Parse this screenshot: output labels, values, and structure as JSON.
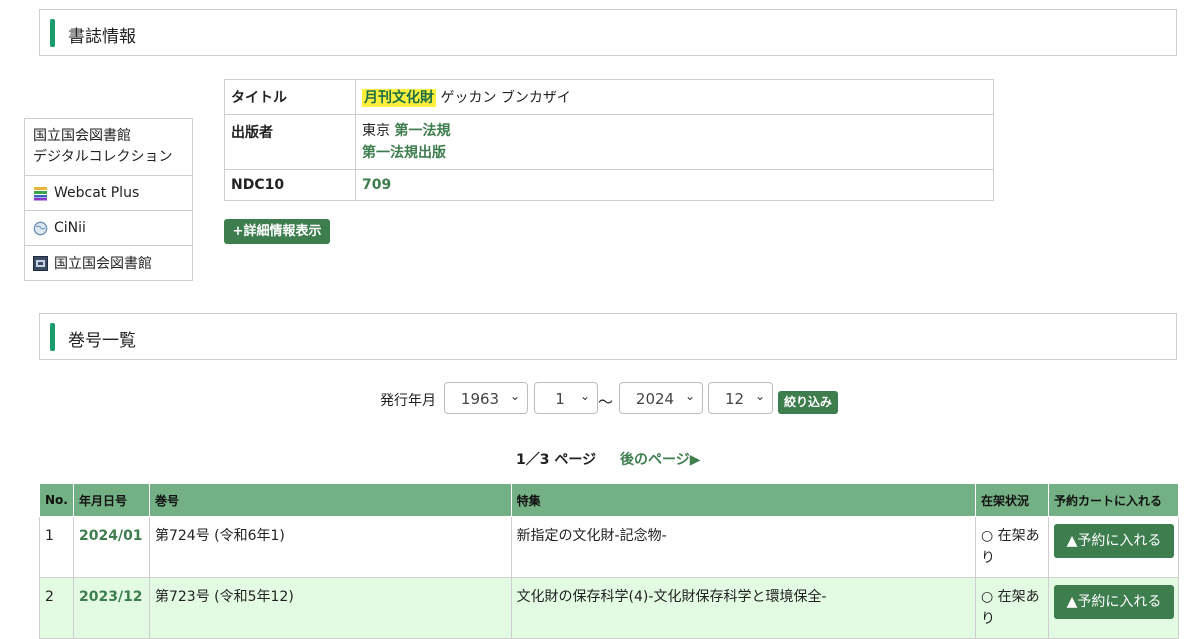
{
  "sections": {
    "biblio_title": "書誌情報",
    "issues_title": "巻号一覧"
  },
  "side_links": [
    {
      "label": "国立国会図書館デジタルコレクション",
      "line1": "国立国会図書館",
      "line2": "デジタルコレクション",
      "icon": ""
    },
    {
      "label": "Webcat Plus",
      "icon": "books-icon"
    },
    {
      "label": "CiNii",
      "icon": "globe-icon"
    },
    {
      "label": "国立国会図書館",
      "icon": "library-icon"
    }
  ],
  "biblio": {
    "title_key": "タイトル",
    "title_main": "月刊文化財",
    "title_reading": "ゲッカン ブンカザイ",
    "publisher_key": "出版者",
    "publisher_place": "東京",
    "publisher_name": "第一法規",
    "publisher_name2": "第一法規出版",
    "ndc_key": "NDC10",
    "ndc_value": "709"
  },
  "detail_button": "+詳細情報表示",
  "filter": {
    "label": "発行年月",
    "from_year": "1963",
    "from_month": "1",
    "separator": "～",
    "to_year": "2024",
    "to_month": "12",
    "button": "絞り込み"
  },
  "pager": {
    "current": "1／3 ページ",
    "next": "後のページ▶"
  },
  "table": {
    "headers": [
      "No.",
      "年月日号",
      "巻号",
      "特集",
      "在架状況",
      "予約カートに入れる"
    ],
    "rows": [
      {
        "no": "1",
        "date": "2024/01",
        "issue": "第724号 (令和6年1)",
        "feature": "新指定の文化財-記念物-",
        "status": "○ 在架あり",
        "button": "▲予約に入れる"
      },
      {
        "no": "2",
        "date": "2023/12",
        "issue": "第723号 (令和5年12)",
        "feature": "文化財の保存科学(4)-文化財保存科学と環境保全-",
        "status": "○ 在架あり",
        "button": "▲予約に入れる"
      }
    ]
  },
  "colors": {
    "accent": "#1a9b6c",
    "button": "#3d7d4e",
    "table_header": "#73b083",
    "row_alt": "#e3fbe3",
    "highlight": "#ffef3d"
  }
}
